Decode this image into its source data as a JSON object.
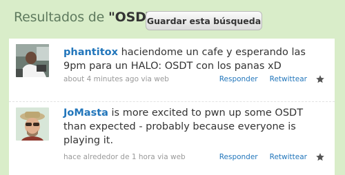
{
  "header": {
    "results_label": "Resultados de ",
    "query": "\"OSDT\"",
    "save_search_label": "Guardar esta búsqueda"
  },
  "statuses": [
    {
      "screen_name": "phantitox",
      "text": " haciendome un cafe y esperando las 9pm para un HALO: OSDT con los panas xD",
      "meta": "about 4 minutes ago via web",
      "reply_label": "Responder",
      "retweet_label": "Retwittear",
      "avatar_icon": "user-avatar-photo"
    },
    {
      "screen_name": "JoMasta",
      "text": " is more excited to pwn up some OSDT than expected - probably because everyone is playing it.",
      "meta": "hace alrededor de 1 hora via web",
      "reply_label": "Responder",
      "retweet_label": "Retwittear",
      "avatar_icon": "user-avatar-photo"
    }
  ],
  "colors": {
    "background": "#d9edc9",
    "link": "#2276bb",
    "meta": "#999999",
    "title": "#5e7a5e"
  }
}
